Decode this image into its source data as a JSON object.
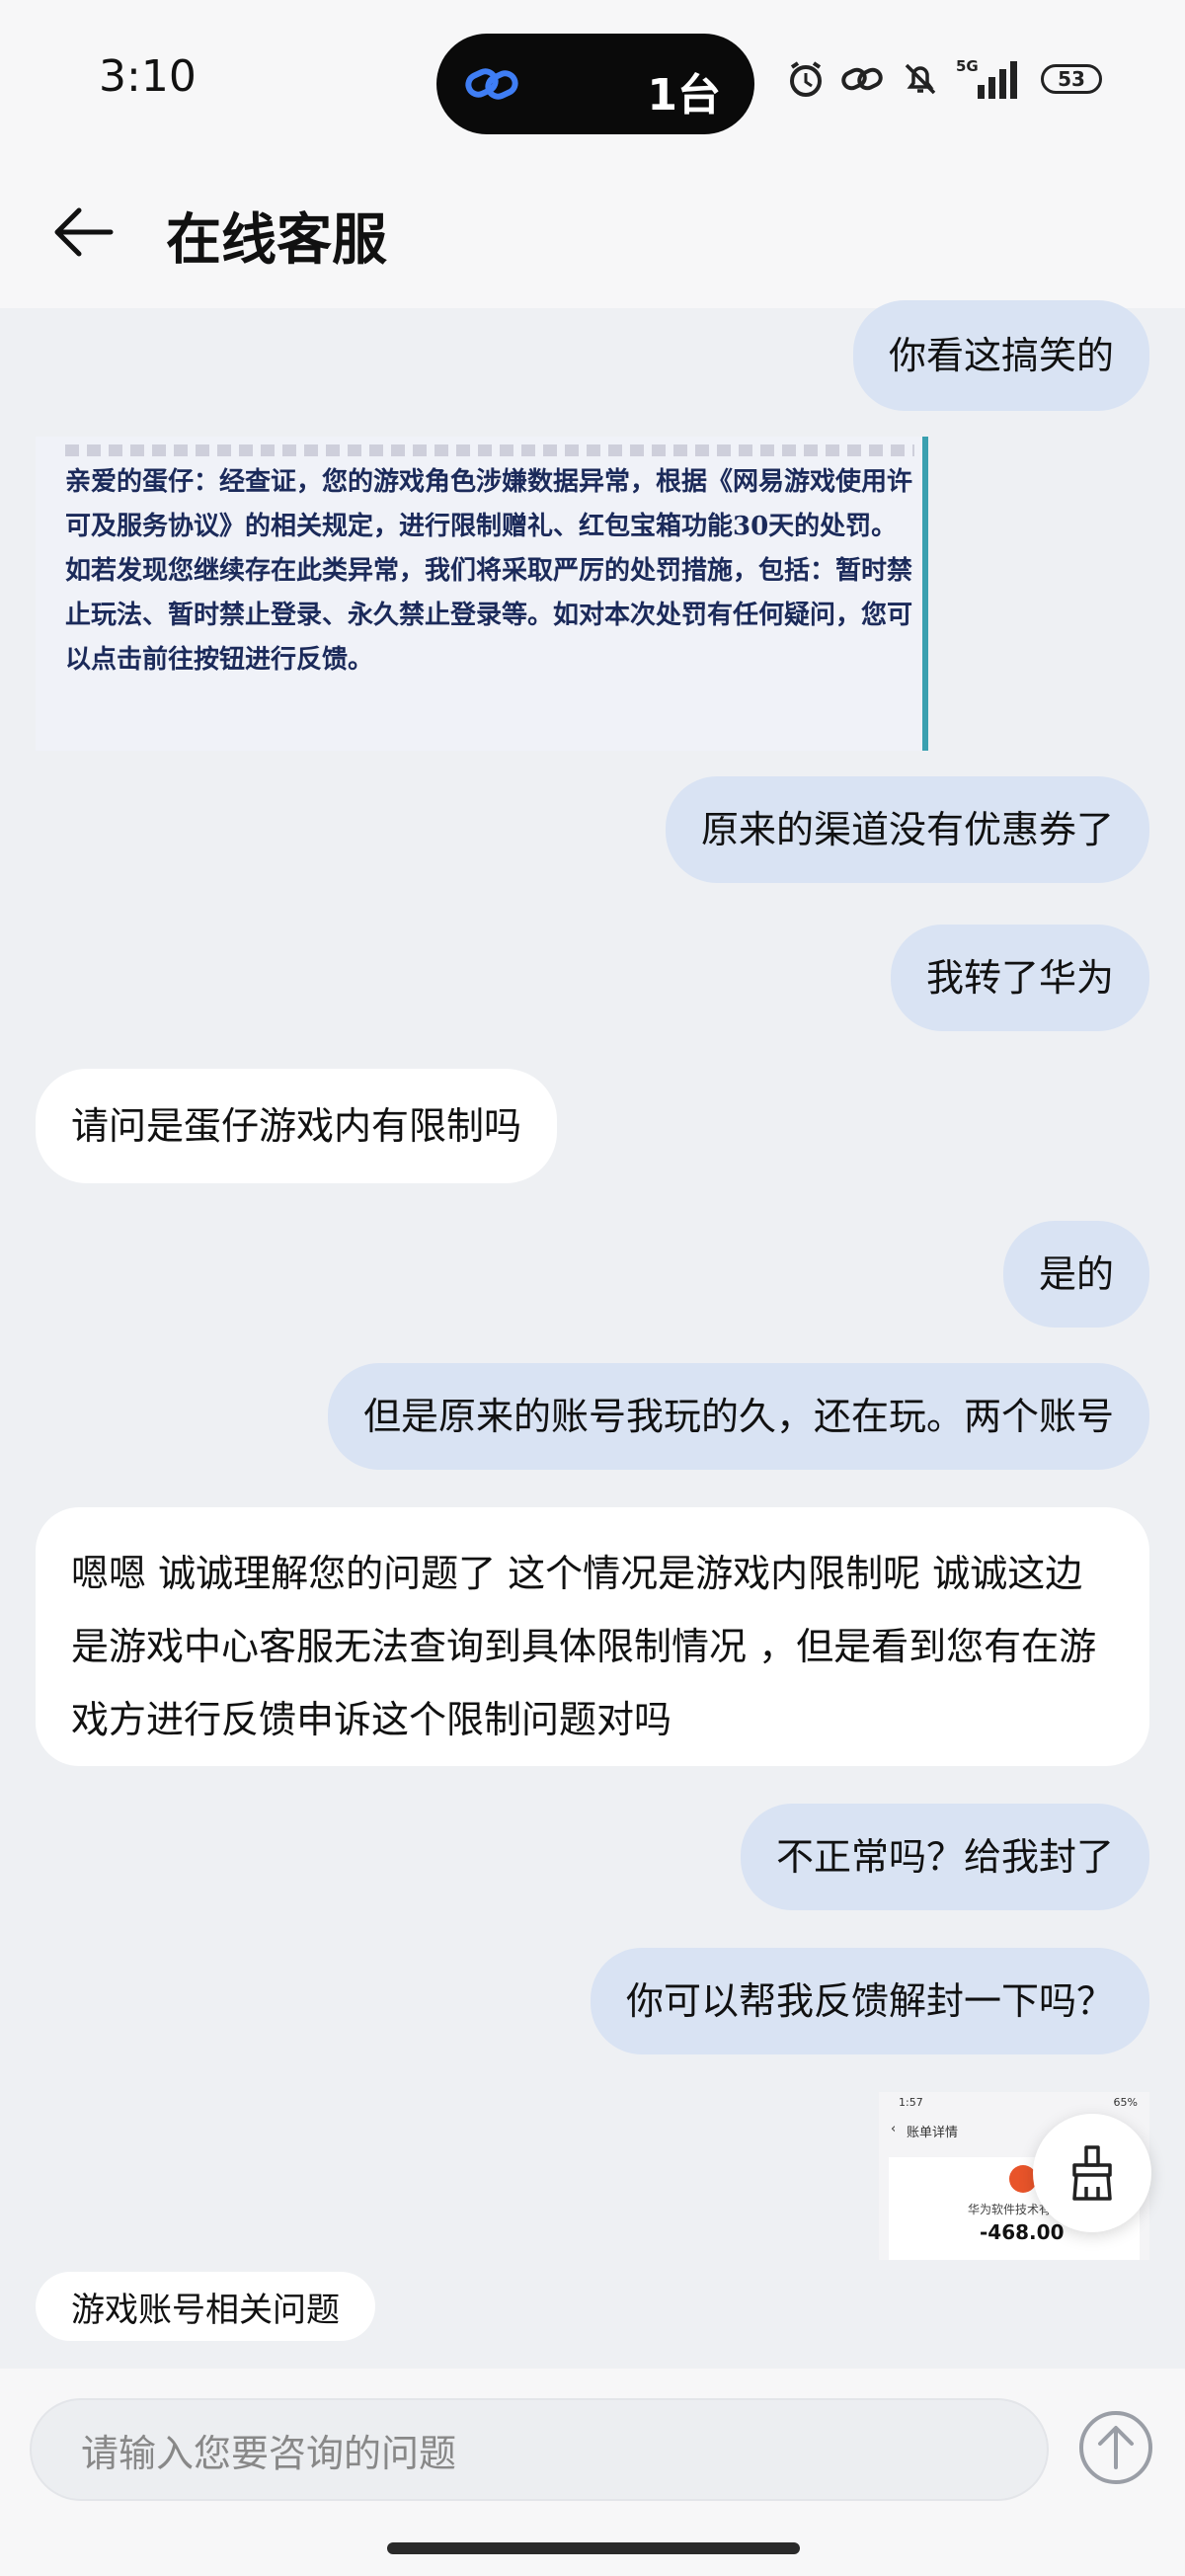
{
  "status_bar": {
    "time": "3:10",
    "island_text": "1台",
    "battery": "53",
    "network": "5G"
  },
  "header": {
    "title": "在线客服"
  },
  "messages": [
    {
      "side": "out",
      "text": "你看这搞笑的"
    },
    {
      "side": "in",
      "type": "image",
      "text": "亲爱的蛋仔：经查证，您的游戏角色涉嫌数据异常，根据《网易游戏使用许可及服务协议》的相关规定，进行限制赠礼、红包宝箱功能30天的处罚。如若发现您继续存在此类异常，我们将采取严厉的处罚措施，包括：暂时禁止玩法、暂时禁止登录、永久禁止登录等。如对本次处罚有任何疑问，您可以点击前往按钮进行反馈。"
    },
    {
      "side": "out",
      "text": "原来的渠道没有优惠券了"
    },
    {
      "side": "out",
      "text": "我转了华为"
    },
    {
      "side": "in",
      "text": "请问是蛋仔游戏内有限制吗"
    },
    {
      "side": "out",
      "text": "是的"
    },
    {
      "side": "out",
      "text": "但是原来的账号我玩的久，还在玩。两个账号"
    },
    {
      "side": "in",
      "text": "嗯嗯 诚诚理解您的问题了 这个情况是游戏内限制呢 诚诚这边是游戏中心客服无法查询到具体限制情况 ，但是看到您有在游戏方进行反馈申诉这个限制问题对吗"
    },
    {
      "side": "out",
      "text": "不正常吗？给我封了"
    },
    {
      "side": "out",
      "text": "你可以帮我反馈解封一下吗？"
    }
  ],
  "thumbnail": {
    "status_time": "1:57",
    "status_right": "65%",
    "title": "账单详情",
    "merchant": "华为软件技术有限",
    "amount": "-468.00"
  },
  "quick_chip": "游戏账号相关问题",
  "input": {
    "placeholder": "请输入您要咨询的问题"
  },
  "icons": {
    "back": "arrow-left-icon",
    "send": "arrow-up-circle-icon",
    "clear": "broom-icon"
  }
}
